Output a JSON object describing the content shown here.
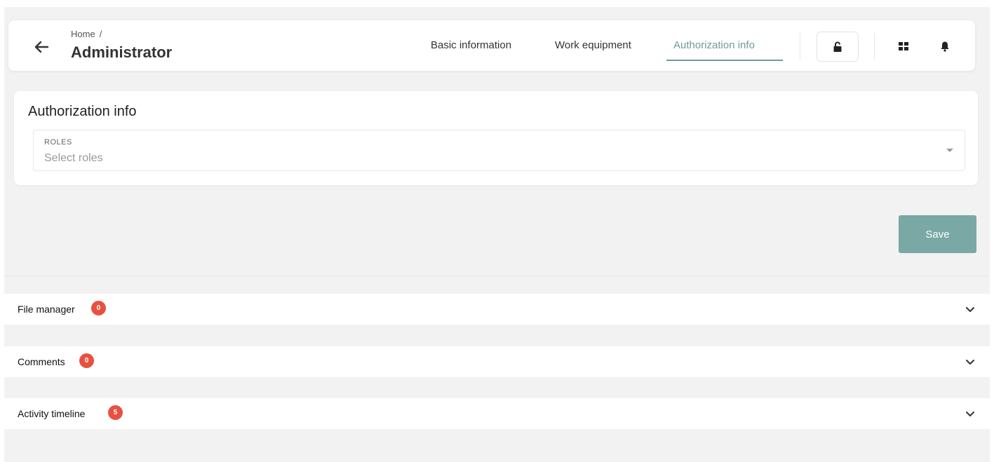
{
  "header": {
    "breadcrumb": "Home",
    "breadcrumb_sep": "/",
    "title": "Administrator",
    "tabs": [
      {
        "label": "Basic information",
        "active": false
      },
      {
        "label": "Work equipment",
        "active": false
      },
      {
        "label": "Authorization info",
        "active": true
      }
    ],
    "icons": [
      "back-arrow-icon",
      "unlock-icon",
      "grid-icon",
      "bell-icon"
    ]
  },
  "authorization": {
    "title": "Authorization info",
    "roles_label": "ROLES",
    "roles_placeholder": "Select roles"
  },
  "save_label": "Save",
  "panels": [
    {
      "title": "File manager",
      "count": "0"
    },
    {
      "title": "Comments",
      "count": "0"
    },
    {
      "title": "Activity timeline",
      "count": "5"
    }
  ],
  "colors": {
    "accent": "#6e9c9a",
    "save_button": "#7aa8a4",
    "badge": "#e8513f",
    "background": "#f2f2f2"
  }
}
